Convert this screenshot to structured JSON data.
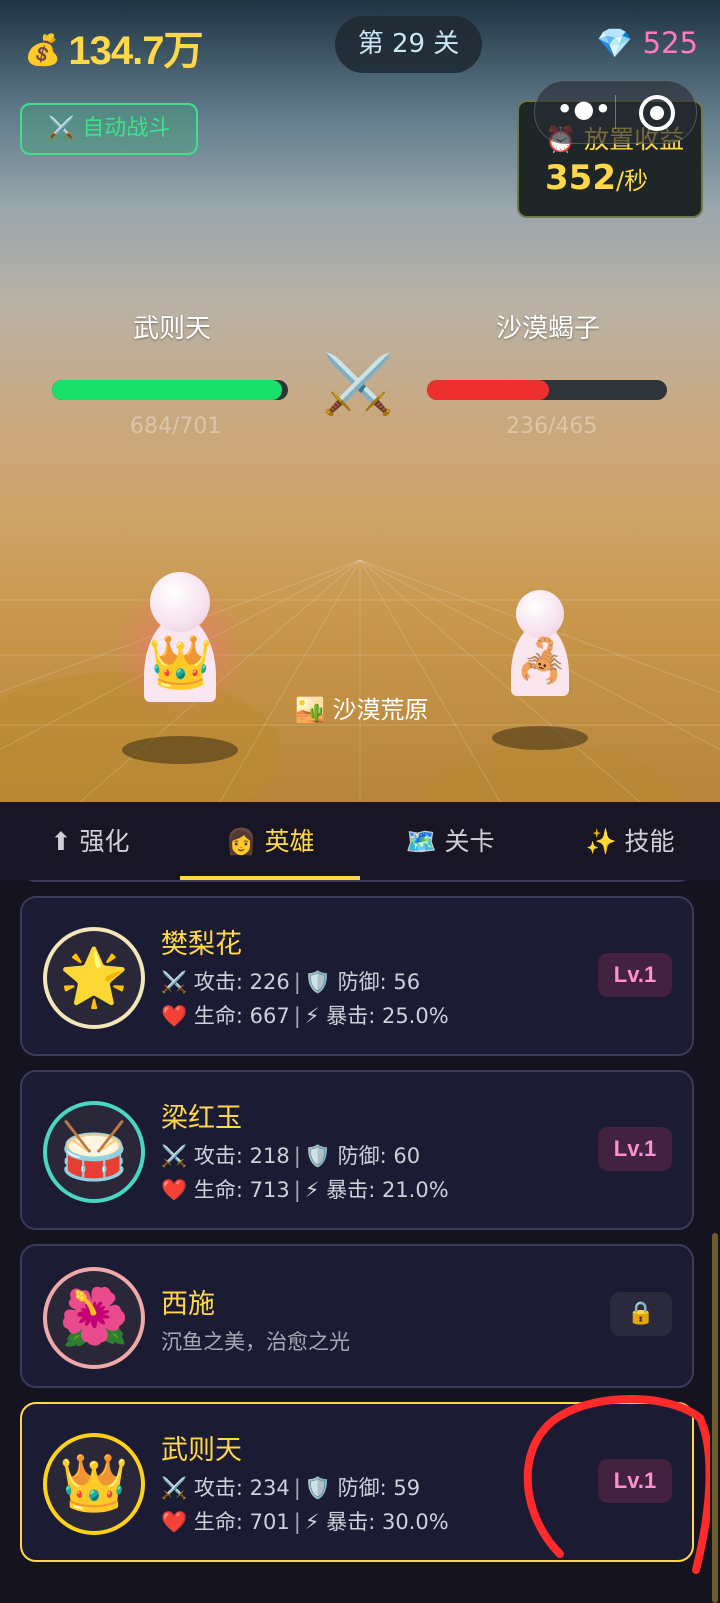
{
  "top": {
    "gold_icon": "💰",
    "gold": "134.7万",
    "level": "第 29 关",
    "gem_icon": "💎",
    "gems": "525"
  },
  "auto_battle": {
    "icon": "⚔️",
    "label": "自动战斗"
  },
  "idle_income": {
    "icon": "⏰",
    "label": "放置收益",
    "value": "352",
    "unit": "/秒"
  },
  "battle": {
    "hero": {
      "name": "武则天",
      "hp_text": "684/701",
      "hp_fraction": 0.976,
      "color": "#19e06a",
      "icon": "👑"
    },
    "enemy": {
      "name": "沙漠蝎子",
      "hp_text": "236/465",
      "hp_fraction": 0.508,
      "color": "#ef2e2e",
      "icon": "🦂"
    },
    "vs_icon": "⚔️",
    "map_icon": "🏜️",
    "map_name": "沙漠荒原"
  },
  "tabs": [
    {
      "icon": "⬆",
      "label": "强化",
      "active": false
    },
    {
      "icon": "👩",
      "label": "英雄",
      "active": true
    },
    {
      "icon": "🗺️",
      "label": "关卡",
      "active": false
    },
    {
      "icon": "✨",
      "label": "技能",
      "active": false
    }
  ],
  "heroes": [
    {
      "name": "樊梨花",
      "avatar": "🌟",
      "ring": "#f3e6b9",
      "atk": "攻击: 226",
      "def": "防御: 56",
      "hp": "生命: 667",
      "crit": "暴击: 25.0%",
      "level": "Lv.1"
    },
    {
      "name": "梁红玉",
      "avatar": "🥁",
      "ring": "#49d6c2",
      "atk": "攻击: 218",
      "def": "防御: 60",
      "hp": "生命: 713",
      "crit": "暴击: 21.0%",
      "level": "Lv.1"
    },
    {
      "name": "西施",
      "avatar": "🌺",
      "ring": "#f0a9a9",
      "desc": "沉鱼之美，治愈之光",
      "lock": "🔒"
    },
    {
      "name": "武则天",
      "avatar": "👑",
      "ring": "#ffd21a",
      "atk": "攻击: 234",
      "def": "防御: 59",
      "hp": "生命: 701",
      "crit": "暴击: 30.0%",
      "level": "Lv.1"
    }
  ],
  "stat_icons": {
    "atk": "⚔️",
    "def": "🛡️",
    "hp": "❤️",
    "crit": "⚡",
    "sep": "|"
  },
  "annotation_color": "#ff2a2a"
}
